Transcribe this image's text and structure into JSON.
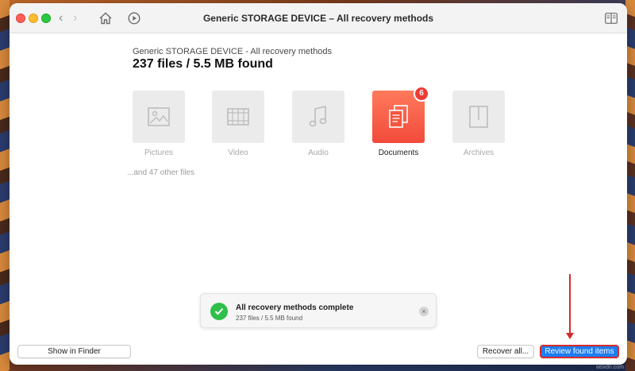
{
  "window": {
    "title": "Generic STORAGE DEVICE – All recovery methods"
  },
  "toolbar": {
    "back_icon": "chevron-left-icon",
    "forward_icon": "chevron-right-icon",
    "home_icon": "home-icon",
    "recent_icon": "play-history-icon",
    "sidebar_icon": "sidebar-toggle-icon"
  },
  "header": {
    "device_title": "Generic STORAGE DEVICE - All recovery methods",
    "found_summary": "237 files / 5.5 MB found"
  },
  "categories": [
    {
      "label": "Pictures",
      "icon": "picture-icon",
      "active": false
    },
    {
      "label": "Video",
      "icon": "film-icon",
      "active": false
    },
    {
      "label": "Audio",
      "icon": "music-note-icon",
      "active": false
    },
    {
      "label": "Documents",
      "icon": "documents-icon",
      "active": true,
      "badge": "6"
    },
    {
      "label": "Archives",
      "icon": "archive-icon",
      "active": false
    }
  ],
  "other_files": "...and 47 other files",
  "toast": {
    "title": "All recovery methods complete",
    "subtitle": "237 files / 5.5 MB found",
    "close": "×"
  },
  "footer": {
    "show_in_finder": "Show in Finder",
    "recover_all": "Recover all...",
    "review_found_items": "Review found items"
  },
  "annotation": {
    "color": "#d62b2b"
  },
  "colors": {
    "accent": "#1e7cf2",
    "documents_tile": "#f24a3b",
    "success": "#2fbf4a"
  },
  "watermark": "wsxdn.com"
}
